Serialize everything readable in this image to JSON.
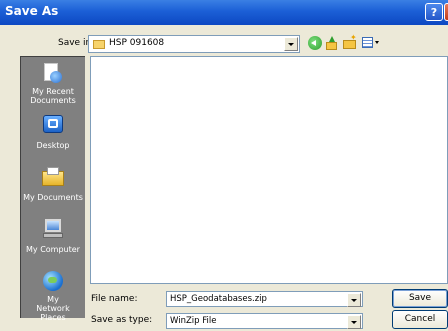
{
  "window": {
    "title": "Save As",
    "help_label": "?",
    "close_label": "✕"
  },
  "savein": {
    "label": "Save in:",
    "value": "HSP 091608"
  },
  "toolbar": {
    "icons": [
      "back-icon",
      "up-folder-icon",
      "new-folder-icon",
      "views-menu-icon"
    ]
  },
  "places": [
    {
      "label": "My Recent Documents",
      "icon": "recent-documents-icon"
    },
    {
      "label": "Desktop",
      "icon": "desktop-icon"
    },
    {
      "label": "My Documents",
      "icon": "my-documents-icon"
    },
    {
      "label": "My Computer",
      "icon": "my-computer-icon"
    },
    {
      "label": "My Network Places",
      "icon": "network-places-icon"
    }
  ],
  "filename": {
    "label": "File name:",
    "value": "HSP_Geodatabases.zip"
  },
  "filetype": {
    "label": "Save as type:",
    "value": "WinZip File"
  },
  "buttons": {
    "save": "Save",
    "cancel": "Cancel"
  }
}
